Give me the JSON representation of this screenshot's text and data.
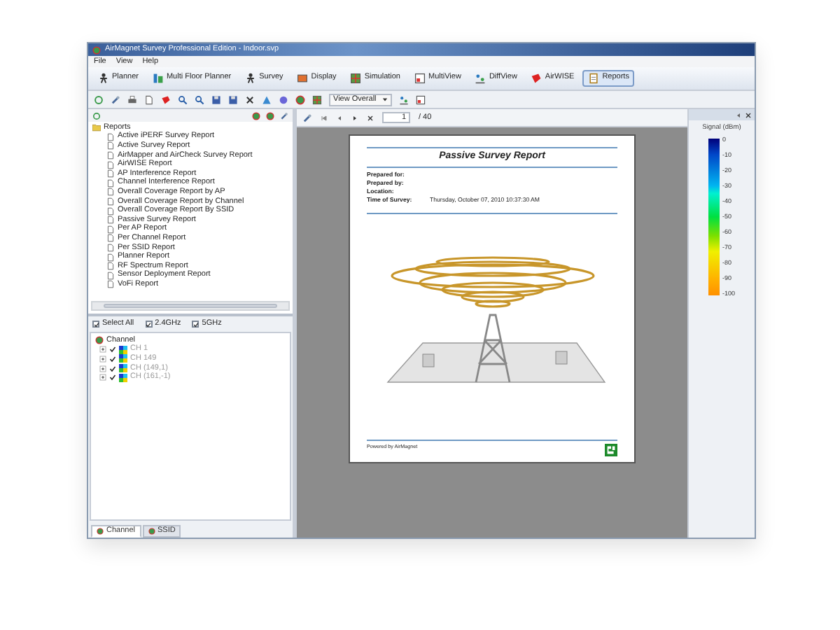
{
  "window": {
    "title": "AirMagnet Survey Professional Edition - Indoor.svp"
  },
  "menu": [
    "File",
    "View",
    "Help"
  ],
  "main_tabs": [
    {
      "label": "Planner",
      "selected": false
    },
    {
      "label": "Multi Floor Planner",
      "selected": false
    },
    {
      "label": "Survey",
      "selected": false
    },
    {
      "label": "Display",
      "selected": false
    },
    {
      "label": "Simulation",
      "selected": false
    },
    {
      "label": "MultiView",
      "selected": false
    },
    {
      "label": "DiffView",
      "selected": false
    },
    {
      "label": "AirWISE",
      "selected": false
    },
    {
      "label": "Reports",
      "selected": true
    }
  ],
  "toolbar": {
    "view_dropdown": "View Overall"
  },
  "reports_tree": {
    "label": "Reports",
    "expanded": true,
    "children": [
      {
        "label": "Active iPERF Survey Report"
      },
      {
        "label": "Active Survey Report"
      },
      {
        "label": "AirMapper and AirCheck Survey Report"
      },
      {
        "label": "AirWISE Report"
      },
      {
        "label": "AP Interference Report"
      },
      {
        "label": "Channel Interference Report"
      },
      {
        "label": "Overall Coverage Report by AP"
      },
      {
        "label": "Overall Coverage Report by Channel"
      },
      {
        "label": "Overall Coverage Report By SSID"
      },
      {
        "label": "Passive Survey Report"
      },
      {
        "label": "Per AP Report"
      },
      {
        "label": "Per Channel Report"
      },
      {
        "label": "Per SSID Report"
      },
      {
        "label": "Planner Report"
      },
      {
        "label": "RF Spectrum Report"
      },
      {
        "label": "Sensor Deployment Report"
      },
      {
        "label": "VoFi Report"
      }
    ]
  },
  "band_filters": [
    {
      "label": "Select All",
      "checked": true
    },
    {
      "label": "2.4GHz",
      "checked": true
    },
    {
      "label": "5GHz",
      "checked": true
    }
  ],
  "channel_tree": {
    "label": "Channel",
    "children": [
      {
        "label": "CH 1",
        "checked": true
      },
      {
        "label": "CH 149",
        "checked": true
      },
      {
        "label": "CH (149,1)",
        "checked": true
      },
      {
        "label": "CH (161,-1)",
        "checked": true
      }
    ]
  },
  "bottom_tabs": [
    {
      "label": "Channel",
      "selected": true
    },
    {
      "label": "SSID",
      "selected": false
    }
  ],
  "viewer": {
    "page": "1",
    "page_count": "/ 40"
  },
  "report": {
    "title": "Passive Survey Report",
    "fields": [
      {
        "label": "Prepared for:"
      },
      {
        "label": "Prepared by:"
      },
      {
        "label": "Location:"
      },
      {
        "label": "Time of Survey:",
        "value": "Thursday, October 07, 2010 10:37:30 AM"
      }
    ],
    "footer": "Powered by AirMagnet"
  },
  "legend": {
    "title": "Signal (dBm)",
    "ticks": [
      "0",
      "-10",
      "-20",
      "-30",
      "-40",
      "-50",
      "-60",
      "-70",
      "-80",
      "-90",
      "-100"
    ]
  }
}
